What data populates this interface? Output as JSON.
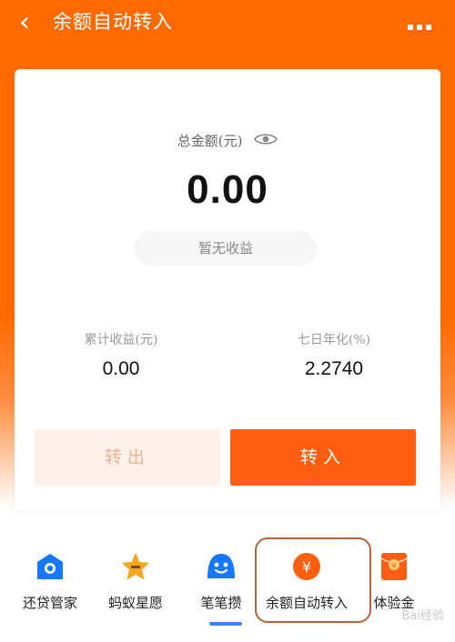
{
  "header": {
    "back_icon": "chevron-left-icon",
    "title": "余额自动转入",
    "more_icon": "more-icon"
  },
  "summary": {
    "total_label": "总金额(元)",
    "eye_icon": "eye-icon",
    "total_amount": "0.00",
    "no_earnings": "暂无收益",
    "cumulative_label": "累计收益(元)",
    "cumulative_value": "0.00",
    "seven_day_label": "七日年化(%)",
    "seven_day_value": "2.2740"
  },
  "buttons": {
    "transfer_out": "转出",
    "transfer_in": "转入"
  },
  "shortcuts": [
    {
      "label": "还贷管家",
      "icon": "house-icon",
      "color": "#1677ff"
    },
    {
      "label": "蚂蚁星愿",
      "icon": "star-icon",
      "color": "#f5a623"
    },
    {
      "label": "笔笔攒",
      "icon": "smile-icon",
      "color": "#1677ff"
    },
    {
      "label": "余额自动转入",
      "icon": "yuan-icon",
      "color": "#ff5e10"
    },
    {
      "label": "体验金",
      "icon": "red-envelope-icon",
      "color": "#ff5e10"
    }
  ],
  "watermark": "Bai经验",
  "colors": {
    "accent": "#ff6a00",
    "button_primary": "#ff5e10",
    "button_secondary": "#fdf1ea"
  }
}
